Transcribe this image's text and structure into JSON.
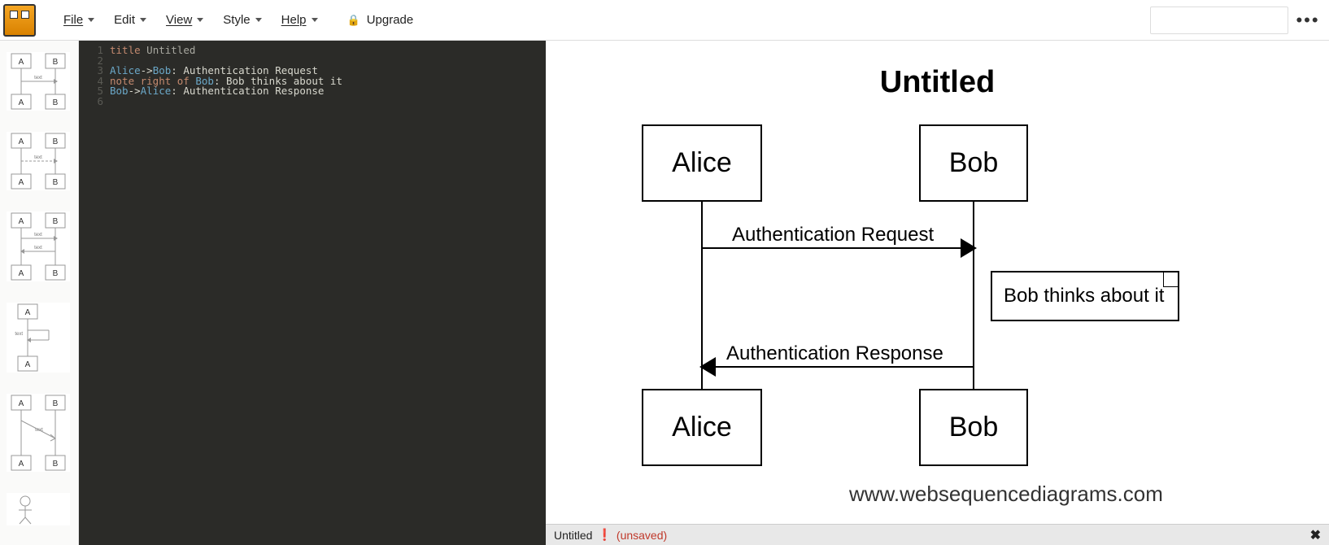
{
  "menu": {
    "file": "File",
    "edit": "Edit",
    "view": "View",
    "style": "Style",
    "help": "Help",
    "upgrade": "Upgrade"
  },
  "editor": {
    "lines": [
      "1",
      "2",
      "3",
      "4",
      "5",
      "6"
    ],
    "code": {
      "l1_key": "title",
      "l1_val": " Untitled",
      "l3_a1": "Alice",
      "l3_arrow": "->",
      "l3_a2": "Bob",
      "l3_rest": ": Authentication Request",
      "l4_key": "note right of ",
      "l4_a": "Bob",
      "l4_rest": ": Bob thinks about it",
      "l5_a1": "Bob",
      "l5_arrow": "->",
      "l5_a2": "Alice",
      "l5_rest": ": Authentication Response"
    }
  },
  "diagram": {
    "title": "Untitled",
    "alice": "Alice",
    "bob": "Bob",
    "msg1": "Authentication Request",
    "note": "Bob thinks about it",
    "msg2": "Authentication Response",
    "watermark": "www.websequencediagrams.com"
  },
  "status": {
    "title": "Untitled",
    "unsaved": "(unsaved)"
  },
  "palette": {
    "a": "A",
    "b": "B",
    "text": "text"
  }
}
